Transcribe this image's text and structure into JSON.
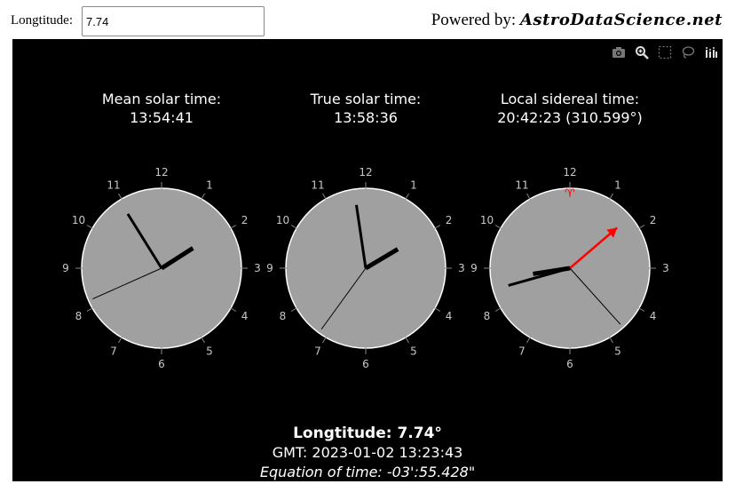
{
  "topbar": {
    "longitude_label": "Longtitude:",
    "longitude_value": "7.74",
    "powered_prefix": "Powered by:",
    "powered_brand": "AstroDataScience.net"
  },
  "modebar": {
    "icons": [
      "camera-icon",
      "zoom-icon",
      "select-box-icon",
      "lasso-icon",
      "plotly-logo-icon"
    ]
  },
  "clocks": [
    {
      "title": "Mean solar time:",
      "time_text": "13:54:41",
      "hour": 13,
      "minute": 54,
      "second": 41,
      "style": "solar"
    },
    {
      "title": "True solar time:",
      "time_text": "13:58:36",
      "hour": 13,
      "minute": 58,
      "second": 36,
      "style": "solar"
    },
    {
      "title": "Local sidereal time:",
      "time_text": "20:42:23 (310.599°)",
      "hour": 20,
      "minute": 42,
      "second": 23,
      "style": "sidereal",
      "aries_symbol": "♈",
      "aries_color": "#ff0000"
    }
  ],
  "dial": {
    "numbers": [
      "12",
      "1",
      "2",
      "3",
      "4",
      "5",
      "6",
      "7",
      "8",
      "9",
      "10",
      "11"
    ],
    "face_color": "#a0a0a0",
    "rim_color": "#ffffff",
    "number_color": "#c8c8c8",
    "hand_color": "#000000"
  },
  "footer": {
    "longitude_line": "Longtitude: 7.74°",
    "gmt_line": "GMT: 2023-01-02 13:23:43",
    "eot_line": "Equation of time: -03':55.428\""
  }
}
